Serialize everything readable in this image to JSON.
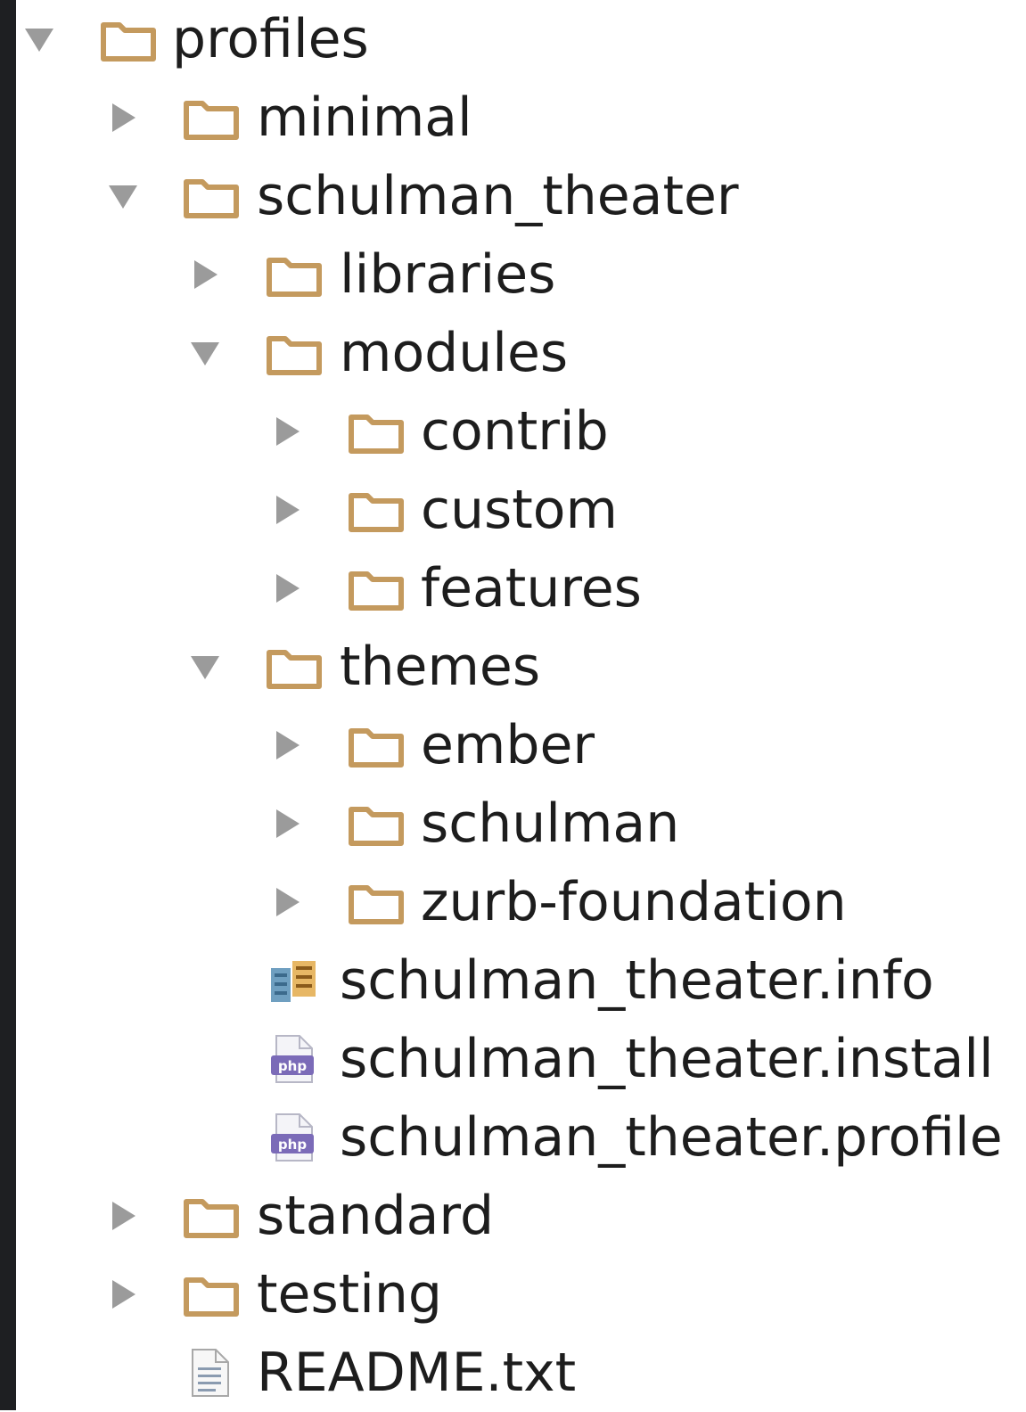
{
  "tree": {
    "profiles": "profiles",
    "minimal": "minimal",
    "schulman_theater": "schulman_theater",
    "libraries": "libraries",
    "modules": "modules",
    "contrib": "contrib",
    "custom": "custom",
    "features": "features",
    "themes": "themes",
    "ember": "ember",
    "schulman": "schulman",
    "zurb_foundation": "zurb-foundation",
    "info_file": "schulman_theater.info",
    "install_file": "schulman_theater.install",
    "profile_file": "schulman_theater.profile",
    "standard": "standard",
    "testing": "testing",
    "readme": "README.txt"
  },
  "icons": {
    "folder": "folder-icon",
    "info_file": "info-file-icon",
    "php_file": "php-file-icon",
    "text_file": "text-file-icon",
    "expanded": "disclosure-expanded-icon",
    "collapsed": "disclosure-collapsed-icon"
  },
  "colors": {
    "folder_outline": "#c49a5e",
    "folder_fill": "#ffffff",
    "disclosure": "#9b9b9b",
    "text": "#1d1d1d",
    "php_badge": "#7b6bb8",
    "left_bar": "#1e1f22"
  }
}
